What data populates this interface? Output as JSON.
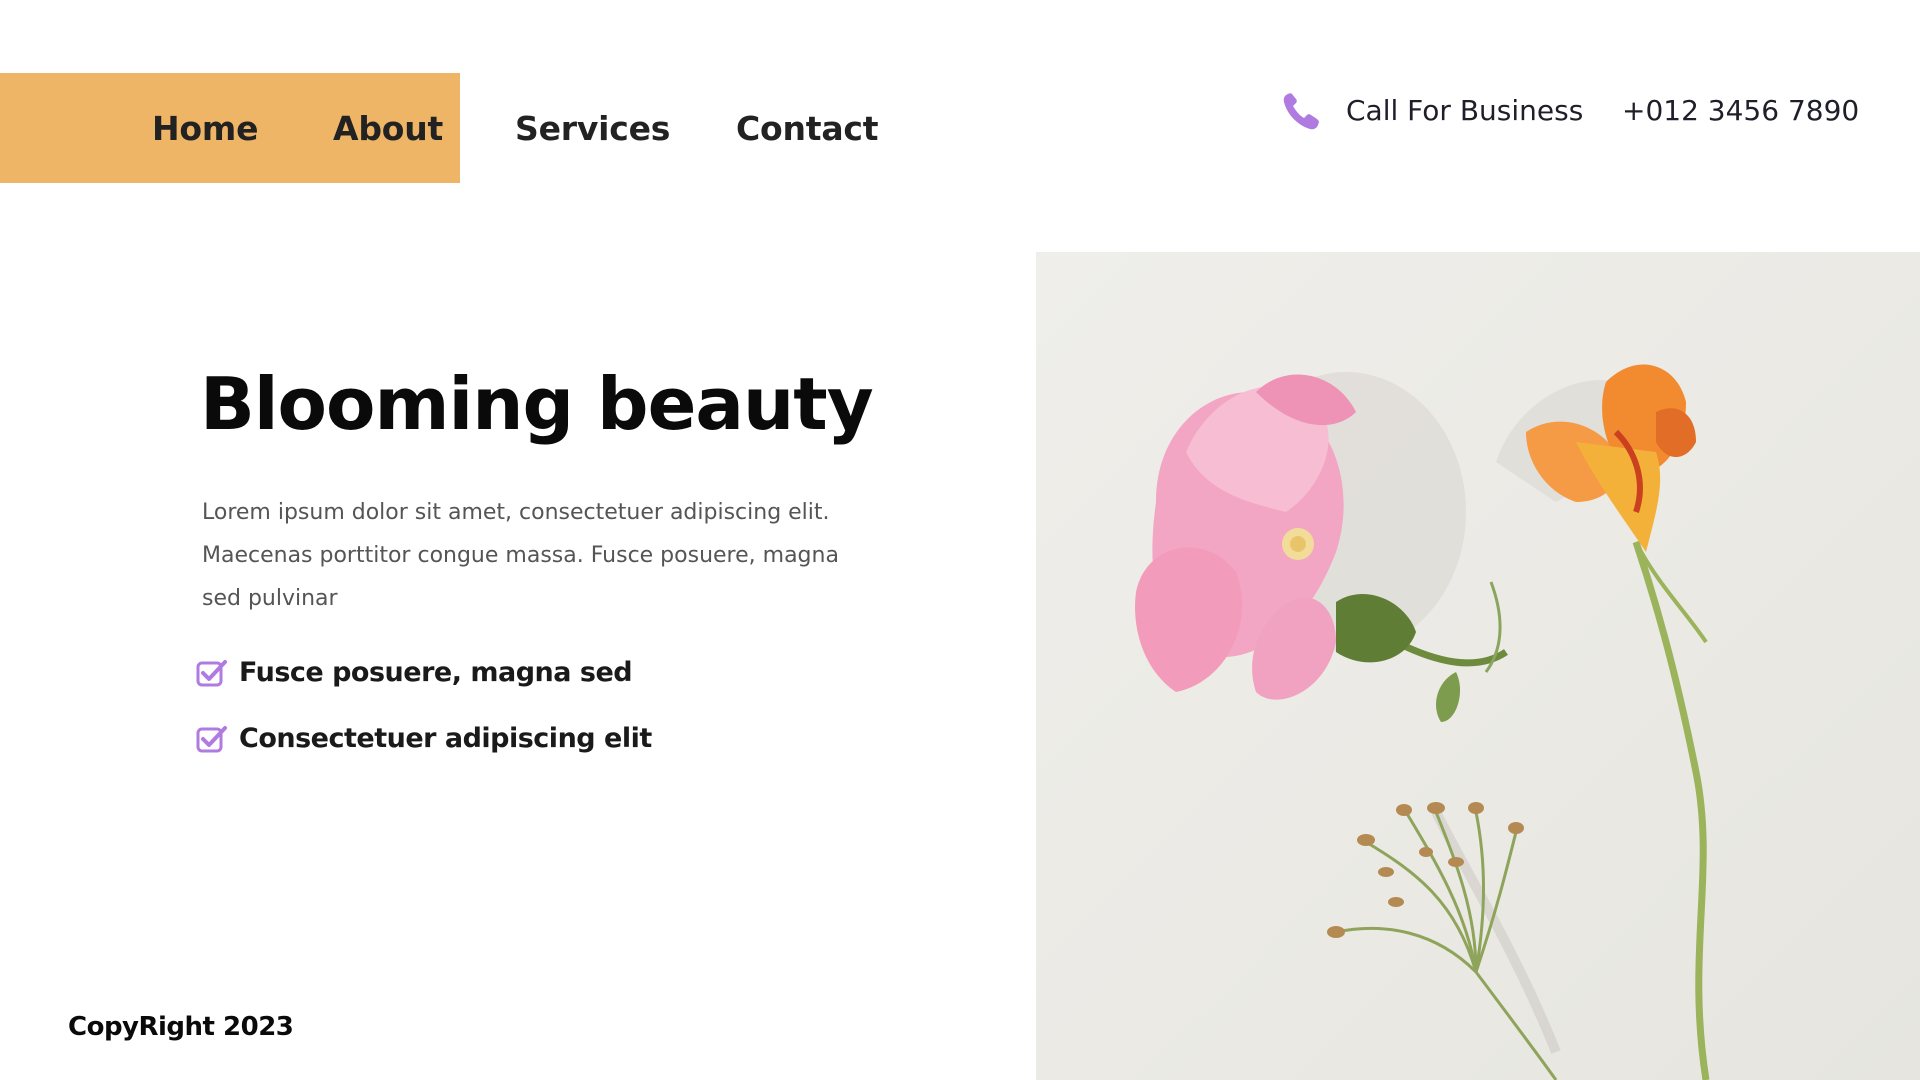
{
  "nav": {
    "items": [
      {
        "label": "Home"
      },
      {
        "label": "About"
      },
      {
        "label": "Services"
      },
      {
        "label": "Contact"
      }
    ],
    "highlight_color": "#EFB566"
  },
  "call": {
    "icon": "phone-icon",
    "label": "Call For Business",
    "number": "+012 3456 7890",
    "icon_color": "#B07BE0"
  },
  "hero": {
    "title": "Blooming beauty",
    "description": "Lorem ipsum dolor sit amet, consectetuer adipiscing elit. Maecenas porttitor congue massa. Fusce posuere, magna sed pulvinar",
    "checklist": [
      {
        "icon": "checkbox-checked-icon",
        "text": "Fusce posuere, magna sed"
      },
      {
        "icon": "checkbox-checked-icon",
        "text": "Consectetuer adipiscing elit"
      }
    ]
  },
  "footer": {
    "copyright": "CopyRight 2023"
  },
  "image": {
    "subject": "flowers-photo"
  }
}
